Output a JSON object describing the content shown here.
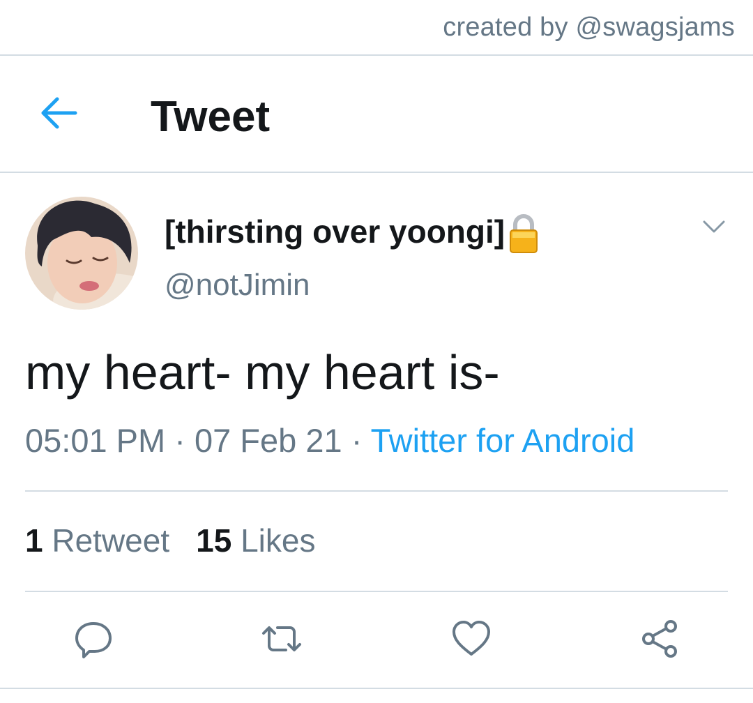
{
  "credit": "created by @swagsjams",
  "header": {
    "title": "Tweet",
    "back_icon": "arrow-left-icon"
  },
  "user": {
    "display_name": "[thirsting over yoongi]",
    "handle": "@notJimin",
    "protected_icon": "lock-icon"
  },
  "tweet": {
    "text": "my heart- my heart is-",
    "time": "05:01 PM",
    "separator": " · ",
    "date": "07 Feb 21",
    "source": "Twitter for Android"
  },
  "stats": {
    "retweets_count": "1",
    "retweets_label": "Retweet",
    "likes_count": "15",
    "likes_label": "Likes"
  },
  "actions": [
    "reply-icon",
    "retweet-icon",
    "like-icon",
    "share-icon"
  ],
  "colors": {
    "accent": "#1da1f2",
    "secondary_text": "#657786",
    "primary_text": "#14171a",
    "divider": "#d3dce3"
  }
}
